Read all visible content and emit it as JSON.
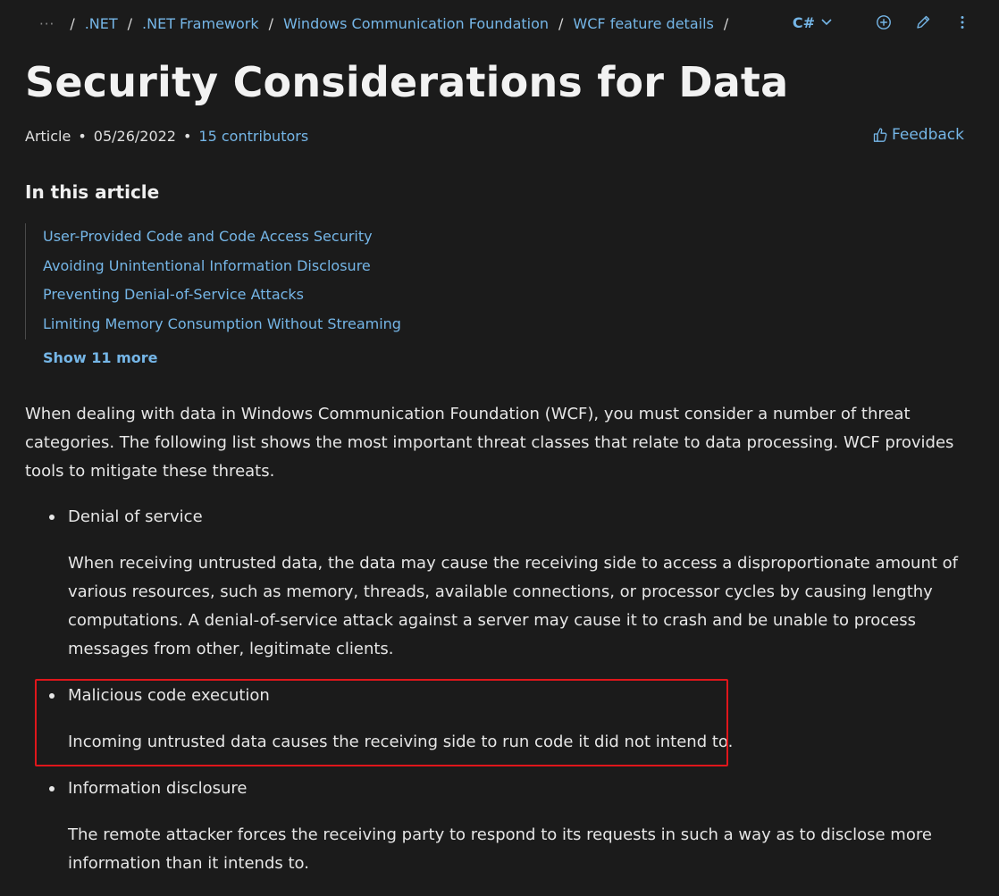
{
  "breadcrumb": {
    "more_label": "···",
    "separator": "/",
    "items": [
      {
        "label": ".NET"
      },
      {
        "label": ".NET Framework"
      },
      {
        "label": "Windows Communication Foundation"
      },
      {
        "label": "WCF feature details"
      }
    ]
  },
  "toolbar": {
    "language": "C#",
    "icons": [
      "chevron-down-icon",
      "add-circle-icon",
      "edit-pencil-icon",
      "more-vertical-icon"
    ]
  },
  "article": {
    "title": "Security Considerations for Data",
    "type": "Article",
    "date": "05/26/2022",
    "contributors": "15 contributors",
    "feedback_label": "Feedback"
  },
  "toc": {
    "heading": "In this article",
    "items": [
      {
        "label": "User-Provided Code and Code Access Security"
      },
      {
        "label": "Avoiding Unintentional Information Disclosure"
      },
      {
        "label": "Preventing Denial-of-Service Attacks"
      },
      {
        "label": "Limiting Memory Consumption Without Streaming"
      }
    ],
    "show_more": "Show 11 more"
  },
  "content": {
    "intro": "When dealing with data in Windows Communication Foundation (WCF), you must consider a number of threat categories. The following list shows the most important threat classes that relate to data processing. WCF provides tools to mitigate these threats.",
    "threats": [
      {
        "name": "Denial of service",
        "description": "When receiving untrusted data, the data may cause the receiving side to access a disproportionate amount of various resources, such as memory, threads, available connections, or processor cycles by causing lengthy computations. A denial-of-service attack against a server may cause it to crash and be unable to process messages from other, legitimate clients."
      },
      {
        "name": "Malicious code execution",
        "description": "Incoming untrusted data causes the receiving side to run code it did not intend to."
      },
      {
        "name": "Information disclosure",
        "description": "The remote attacker forces the receiving party to respond to its requests in such a way as to disclose more information than it intends to."
      }
    ]
  },
  "colors": {
    "background": "#1b1b1b",
    "link": "#75b6e7",
    "text": "#e6e6e6",
    "highlight_border": "#e0161b"
  }
}
